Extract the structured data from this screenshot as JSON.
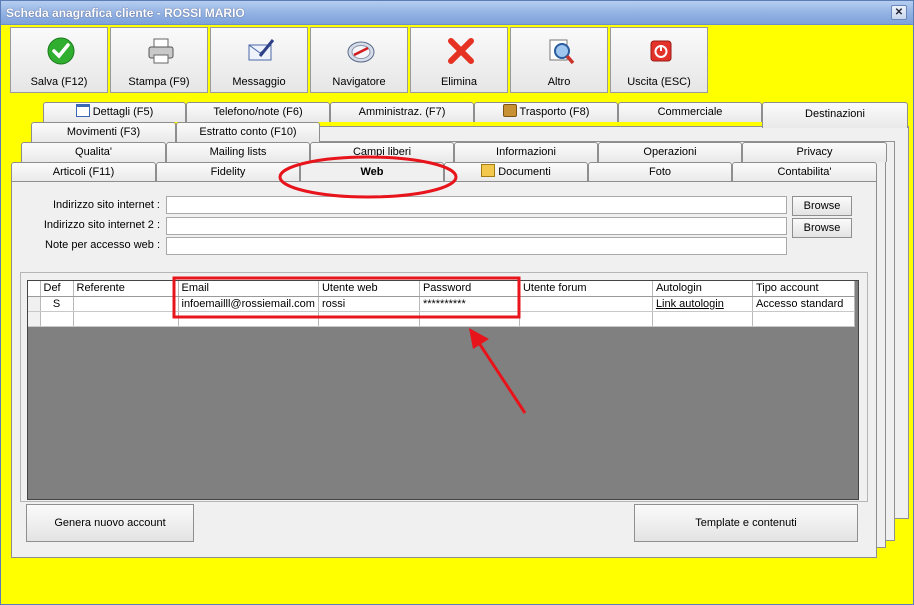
{
  "window": {
    "title": "Scheda anagrafica cliente - ROSSI MARIO",
    "close_glyph": "✕"
  },
  "toolbar": [
    {
      "label": "Salva (F12)",
      "icon": "check-icon"
    },
    {
      "label": "Stampa (F9)",
      "icon": "printer-icon"
    },
    {
      "label": "Messaggio",
      "icon": "envelope-pen-icon"
    },
    {
      "label": "Navigatore",
      "icon": "compass-icon"
    },
    {
      "label": "Elimina",
      "icon": "delete-x-icon"
    },
    {
      "label": "Altro",
      "icon": "magnifier-icon"
    },
    {
      "label": "Uscita (ESC)",
      "icon": "power-icon"
    }
  ],
  "tabs": {
    "row1": [
      "Dettagli (F5)",
      "Telefono/note (F6)",
      "Amministraz. (F7)",
      "Trasporto (F8)",
      "Commerciale",
      "Destinazioni"
    ],
    "row2": [
      "Movimenti (F3)",
      "Estratto conto (F10)"
    ],
    "row3": [
      "Qualita'",
      "Mailing lists",
      "Campi liberi",
      "Informazioni",
      "Operazioni",
      "Privacy"
    ],
    "row4": [
      "Articoli (F11)",
      "Fidelity",
      "Web",
      "Documenti",
      "Foto",
      "Contabilita'"
    ],
    "active": "Web"
  },
  "web": {
    "site_label": "Indirizzo sito internet :",
    "site2_label": "Indirizzo sito internet 2 :",
    "notes_label": "Note per accesso web :",
    "site_value": "",
    "site2_value": "",
    "notes_value": "",
    "browse_label": "Browse"
  },
  "grid": {
    "columns": [
      "Def",
      "Referente",
      "Email",
      "Utente web",
      "Password",
      "Utente forum",
      "Autologin",
      "Tipo account"
    ],
    "rows": [
      [
        "S",
        "",
        "infoemailll@rossiemail.com",
        "rossi",
        "**********",
        "",
        "Link autologin",
        "Accesso standard"
      ],
      [
        "",
        "",
        "",
        "",
        "",
        "",
        "",
        ""
      ]
    ]
  },
  "buttons": {
    "new_account": "Genera nuovo account",
    "templates": "Template e contenuti"
  },
  "colors": {
    "background": "#ffff00",
    "annotation": "#e8141b",
    "grid_empty": "#808080"
  }
}
